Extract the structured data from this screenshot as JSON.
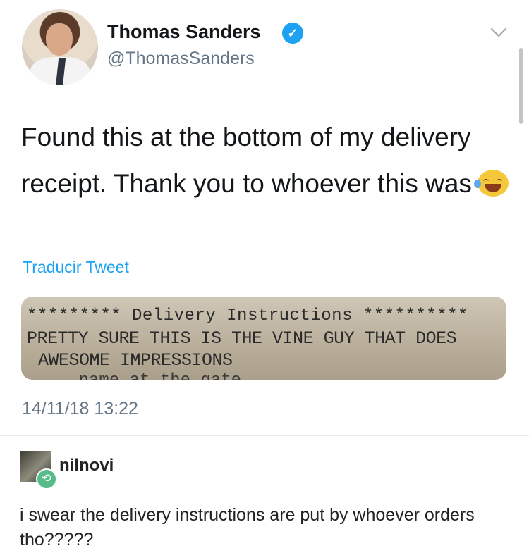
{
  "tweet": {
    "author_name": "Thomas Sanders",
    "handle": "@ThomasSanders",
    "text": "Found this at the bottom of my delivery receipt. Thank you to whoever this was",
    "emoji": "laughing-tears-emoji",
    "translate_label": "Traducir Tweet",
    "receipt_lines": [
      "********* Delivery Instructions **********",
      "PRETTY SURE THIS IS THE VINE GUY THAT DOES",
      "AWESOME IMPRESSIONS",
      "... name at the gate"
    ],
    "timestamp": "14/11/18 13:22"
  },
  "reblog": {
    "username": "nilnovi",
    "comment": "i swear the delivery instructions are put by whoever orders tho?????"
  },
  "colors": {
    "link_blue": "#1da1f2",
    "meta_gray": "#657786",
    "reblog_green": "#56bc8a"
  }
}
